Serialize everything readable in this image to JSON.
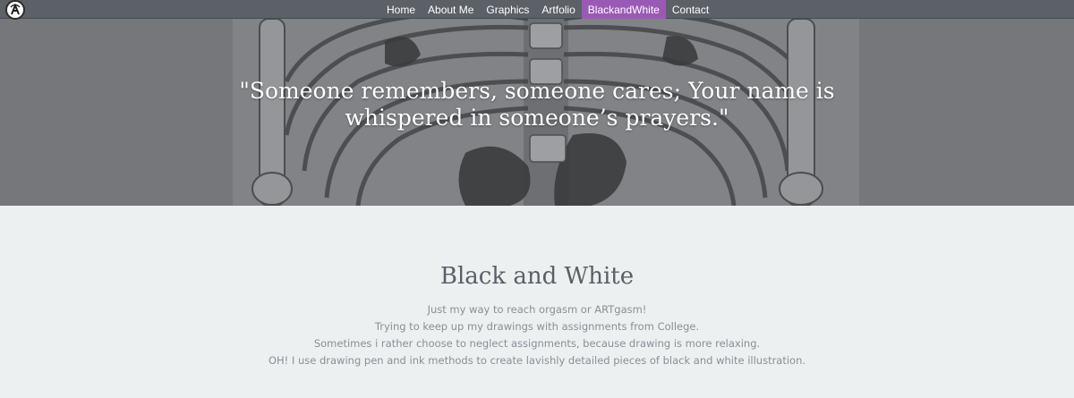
{
  "nav": {
    "logo_icon": "artfolio-logo-icon",
    "items": [
      {
        "label": "Home"
      },
      {
        "label": "About Me"
      },
      {
        "label": "Graphics"
      },
      {
        "label": "Artfolio"
      },
      {
        "label": "BlackandWhite",
        "active": true
      },
      {
        "label": "Contact"
      }
    ],
    "active_color": "#9b59b6",
    "bar_color": "#5c6168"
  },
  "hero": {
    "quote_line1": "\"Someone remembers, someone cares; Your name is",
    "quote_line2": "whispered in someone’s prayers.\""
  },
  "section": {
    "title": "Black and White",
    "lines": [
      "Just my way to reach orgasm or ARTgasm!",
      "Trying to keep up my drawings with assignments from College.",
      "Sometimes i rather choose to neglect assignments, because drawing is more relaxing.",
      "OH! I use drawing pen and ink methods to create lavishly detailed pieces of black and white illustration."
    ]
  }
}
